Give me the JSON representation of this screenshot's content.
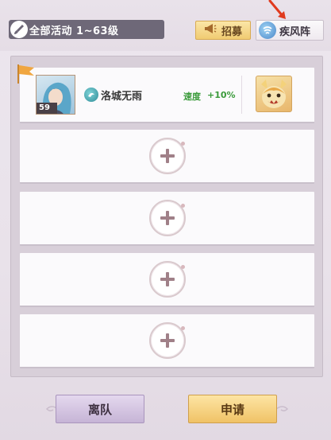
{
  "header": {
    "filter_label": "全部活动 1~63级",
    "recruit_label": "招募",
    "formation_label": "疾风阵"
  },
  "team": {
    "members": [
      {
        "name": "洛城无雨",
        "level": "59",
        "speed_label": "速度",
        "speed_value": "+10%"
      }
    ],
    "empty_slot_count": 4
  },
  "footer": {
    "leave_label": "离队",
    "apply_label": "申请"
  },
  "colors": {
    "speed_text": "#3a9a3a",
    "annotation_arrow": "#e03a1e"
  },
  "icons": {
    "filter": "brush-icon",
    "recruit": "megaphone-icon",
    "formation": "whirlwind-icon",
    "captain": "flag-icon",
    "class": "class-icon",
    "add": "plus-icon"
  }
}
